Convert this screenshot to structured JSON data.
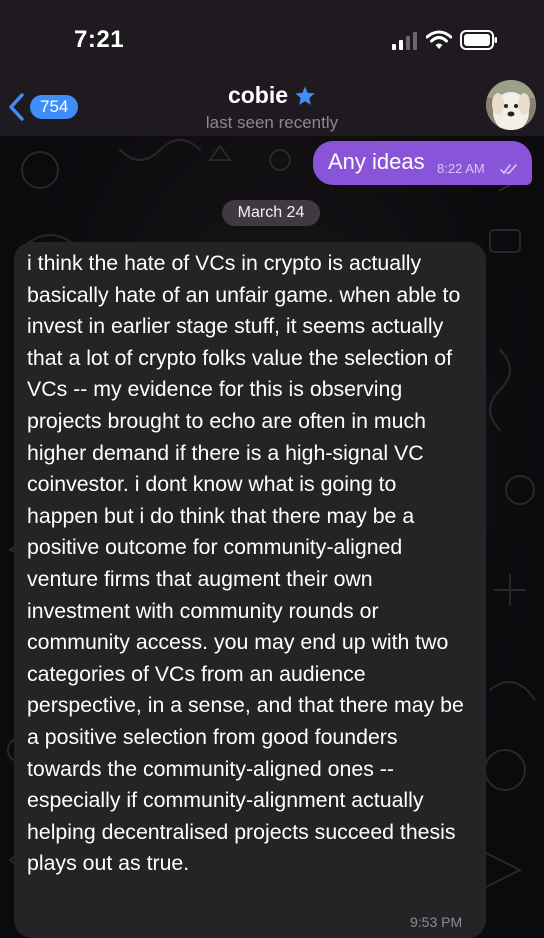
{
  "status_bar": {
    "time": "7:21"
  },
  "header": {
    "back_badge": "754",
    "contact_name": "cobie",
    "contact_status": "last seen recently"
  },
  "messages": {
    "outgoing": {
      "text": "Any ideas",
      "time": "8:22 AM"
    },
    "date_separator": "March 24",
    "incoming": {
      "text": "i think the hate of VCs in crypto is actually basically hate of an unfair game. when able to invest in earlier stage stuff, it seems actually that a lot of crypto folks value the selection of VCs -- my evidence for this is observing projects brought to echo are often in much higher demand if there is a high-signal VC coinvestor. i dont know what is going to happen but i do think that there may be a positive outcome for community-aligned venture firms that augment their own investment with community rounds or community access. you may end up with two categories of VCs from an audience perspective, in a sense, and that there may be a positive selection from good founders towards the community-aligned ones -- especially if community-alignment actually helping decentralised projects succeed thesis plays out as true.",
      "time": "9:53 PM"
    }
  },
  "colors": {
    "outgoing_bubble": "#8a54d8",
    "incoming_bubble": "#262327",
    "badge": "#3f8ef7",
    "header_bg": "#1e1a1f"
  },
  "icons": {
    "verified": "star-icon",
    "back": "chevron-left-icon",
    "read_receipt": "double-check-icon"
  }
}
